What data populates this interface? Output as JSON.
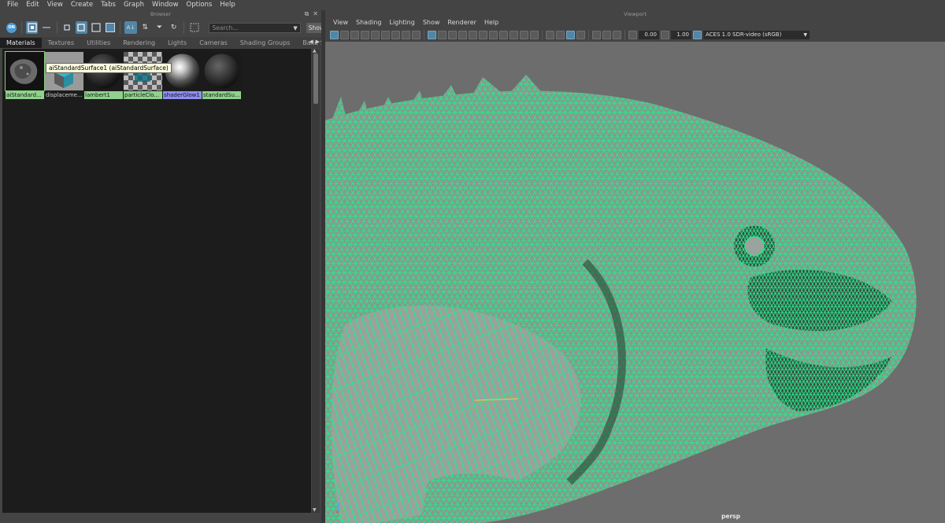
{
  "menubar": [
    "File",
    "Edit",
    "View",
    "Create",
    "Tabs",
    "Graph",
    "Window",
    "Options",
    "Help"
  ],
  "browser": {
    "title": "Browser",
    "search": {
      "placeholder": "Search...",
      "show_label": "Show"
    },
    "tabs": [
      "Materials",
      "Textures",
      "Utilities",
      "Rendering",
      "Lights",
      "Cameras",
      "Shading Groups",
      "Bake S"
    ],
    "active_tab": "Materials",
    "swatches": [
      {
        "label": "aiStandard...",
        "kind": "rock",
        "state": "selected"
      },
      {
        "label": "displaceme...",
        "kind": "cube",
        "state": "normal"
      },
      {
        "label": "lambert1",
        "kind": "sphere-dark",
        "state": "green"
      },
      {
        "label": "particleClo...",
        "kind": "checker",
        "state": "green"
      },
      {
        "label": "shaderGlow1",
        "kind": "sphere-shiny",
        "state": "blue"
      },
      {
        "label": "standardSu...",
        "kind": "sphere-dark",
        "state": "green"
      }
    ],
    "tooltip": "aiStandardSurface1 (aiStandardSurface)"
  },
  "viewport": {
    "title": "Viewport",
    "menu": [
      "View",
      "Shading",
      "Lighting",
      "Show",
      "Renderer",
      "Help"
    ],
    "exposure": "0.00",
    "gamma": "1.00",
    "color_management": "ACES 1.0 SDR-video (sRGB)",
    "camera": "persp"
  },
  "colors": {
    "wireframe": "#27e88a",
    "selection_blue": "#5285a6",
    "label_green": "#8fd18d",
    "label_blue": "#8f8ff2"
  }
}
